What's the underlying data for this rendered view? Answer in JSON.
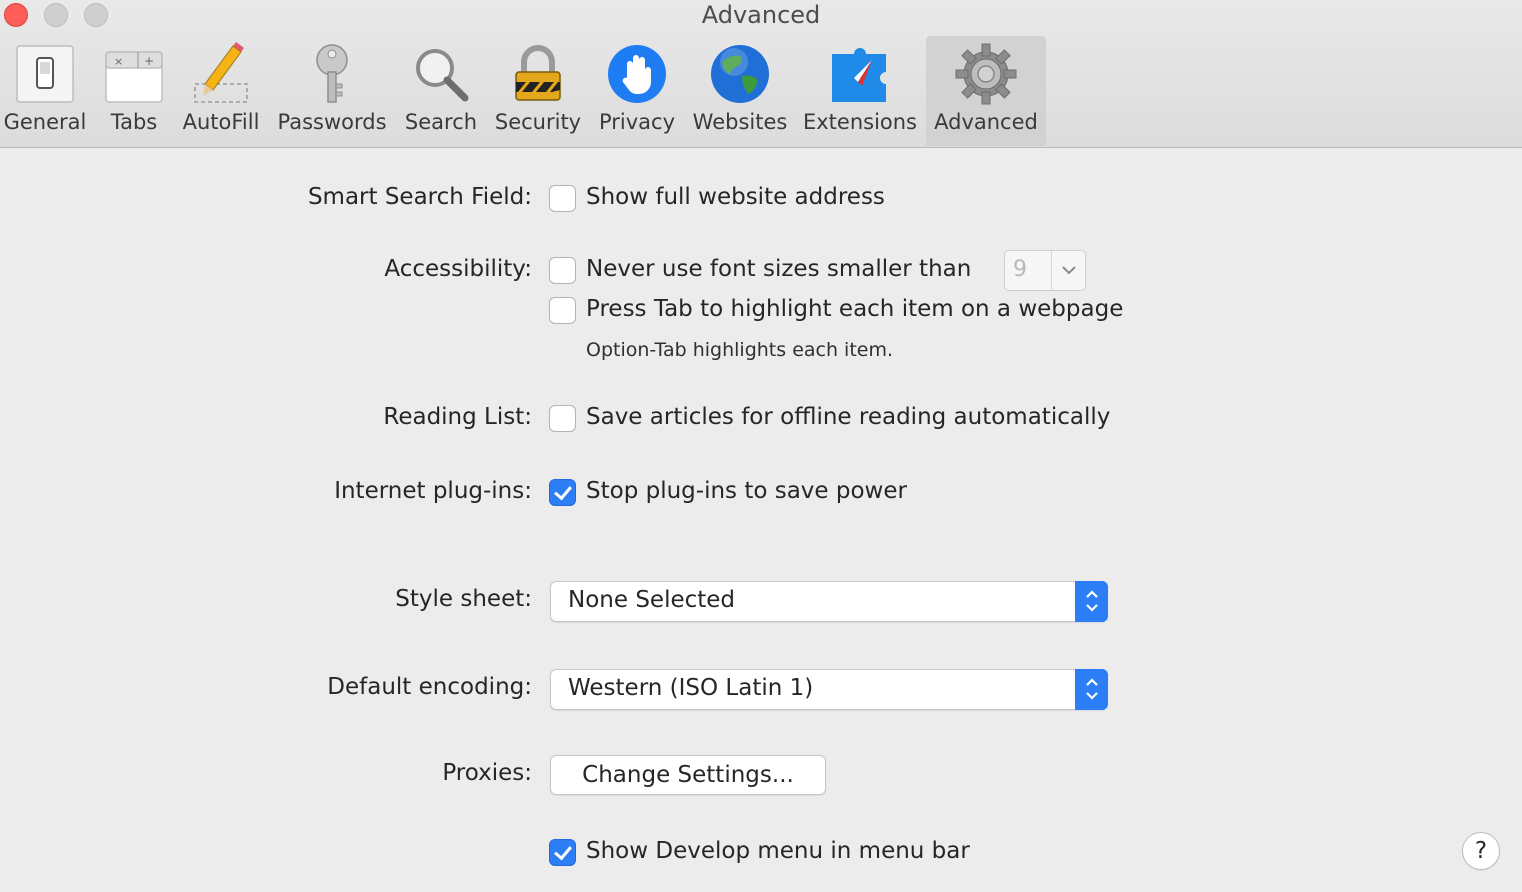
{
  "window": {
    "title": "Advanced"
  },
  "toolbar": {
    "items": [
      {
        "label": "General",
        "icon": "general-switch-icon"
      },
      {
        "label": "Tabs",
        "icon": "tabs-icon"
      },
      {
        "label": "AutoFill",
        "icon": "pencil-icon"
      },
      {
        "label": "Passwords",
        "icon": "key-icon"
      },
      {
        "label": "Search",
        "icon": "magnifier-icon"
      },
      {
        "label": "Security",
        "icon": "padlock-icon"
      },
      {
        "label": "Privacy",
        "icon": "hand-icon"
      },
      {
        "label": "Websites",
        "icon": "globe-icon"
      },
      {
        "label": "Extensions",
        "icon": "puzzle-compass-icon"
      },
      {
        "label": "Advanced",
        "icon": "gear-icon",
        "selected": true
      }
    ]
  },
  "settings": {
    "smart_search": {
      "label": "Smart Search Field:",
      "checkbox": "Show full website address",
      "checked": false
    },
    "accessibility": {
      "label": "Accessibility:",
      "font_size": {
        "checkbox": "Never use font sizes smaller than",
        "checked": false,
        "value": "9"
      },
      "tab_highlight": {
        "checkbox": "Press Tab to highlight each item on a webpage",
        "checked": false
      },
      "note": "Option-Tab highlights each item."
    },
    "reading_list": {
      "label": "Reading List:",
      "checkbox": "Save articles for offline reading automatically",
      "checked": false
    },
    "plugins": {
      "label": "Internet plug-ins:",
      "checkbox": "Stop plug-ins to save power",
      "checked": true
    },
    "style_sheet": {
      "label": "Style sheet:",
      "value": "None Selected"
    },
    "encoding": {
      "label": "Default encoding:",
      "value": "Western (ISO Latin 1)"
    },
    "proxies": {
      "label": "Proxies:",
      "button": "Change Settings..."
    },
    "develop": {
      "checkbox": "Show Develop menu in menu bar",
      "checked": true
    }
  },
  "help": {
    "label": "?"
  },
  "colors": {
    "accent": "#2c7df6",
    "close": "#fd5e57",
    "background": "#ececec"
  }
}
